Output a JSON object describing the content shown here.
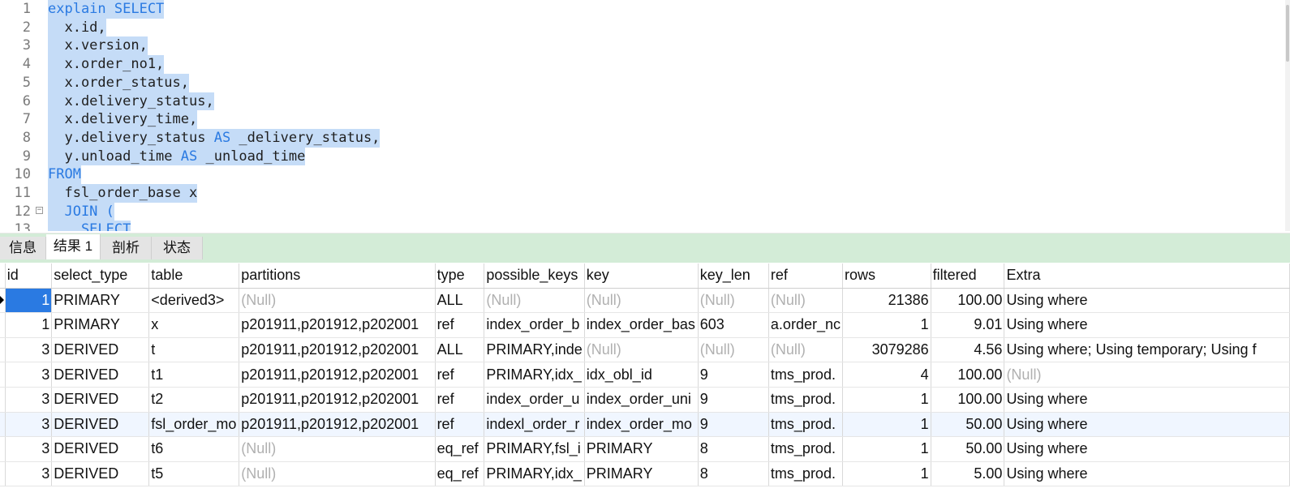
{
  "editor": {
    "lines": [
      {
        "num": "1",
        "parts": [
          {
            "t": "explain SELECT",
            "k": true
          }
        ]
      },
      {
        "num": "2",
        "parts": [
          {
            "t": "  x.id,",
            "k": false
          }
        ]
      },
      {
        "num": "3",
        "parts": [
          {
            "t": "  x.version,",
            "k": false
          }
        ]
      },
      {
        "num": "4",
        "parts": [
          {
            "t": "  x.order_no1,",
            "k": false
          }
        ]
      },
      {
        "num": "5",
        "parts": [
          {
            "t": "  x.order_status,",
            "k": false
          }
        ]
      },
      {
        "num": "6",
        "parts": [
          {
            "t": "  x.delivery_status,",
            "k": false
          }
        ]
      },
      {
        "num": "7",
        "parts": [
          {
            "t": "  x.delivery_time,",
            "k": false
          }
        ]
      },
      {
        "num": "8",
        "parts": [
          {
            "t": "  y.delivery_status ",
            "k": false
          },
          {
            "t": "AS",
            "k": true
          },
          {
            "t": " _delivery_status,",
            "k": false
          }
        ]
      },
      {
        "num": "9",
        "parts": [
          {
            "t": "  y.unload_time ",
            "k": false
          },
          {
            "t": "AS",
            "k": true
          },
          {
            "t": " _unload_time",
            "k": false
          }
        ]
      },
      {
        "num": "10",
        "parts": [
          {
            "t": "FROM",
            "k": true
          }
        ]
      },
      {
        "num": "11",
        "parts": [
          {
            "t": "  fsl_order_base x",
            "k": false
          }
        ]
      },
      {
        "num": "12",
        "parts": [
          {
            "t": "  JOIN (",
            "k": true
          }
        ],
        "fold": "⊟"
      },
      {
        "num": "13",
        "parts": [
          {
            "t": "    SELECT",
            "k": true
          }
        ]
      }
    ]
  },
  "tabs": [
    {
      "label": "信息",
      "active": false
    },
    {
      "label": "结果 1",
      "active": true
    },
    {
      "label": "剖析",
      "active": false
    },
    {
      "label": "状态",
      "active": false
    }
  ],
  "grid": {
    "columns": [
      "id",
      "select_type",
      "table",
      "partitions",
      "type",
      "possible_keys",
      "key",
      "key_len",
      "ref",
      "rows",
      "filtered",
      "Extra"
    ],
    "rows": [
      [
        "1",
        "PRIMARY",
        "<derived3>",
        "(Null)",
        "ALL",
        "(Null)",
        "(Null)",
        "(Null)",
        "(Null)",
        "21386",
        "100.00",
        "Using where"
      ],
      [
        "1",
        "PRIMARY",
        "x",
        "p201911,p201912,p202001",
        "ref",
        "index_order_b",
        "index_order_bas",
        "603",
        "a.order_nc",
        "1",
        "9.01",
        "Using where"
      ],
      [
        "3",
        "DERIVED",
        "t",
        "p201911,p201912,p202001",
        "ALL",
        "PRIMARY,inde",
        "(Null)",
        "(Null)",
        "(Null)",
        "3079286",
        "4.56",
        "Using where; Using temporary; Using f"
      ],
      [
        "3",
        "DERIVED",
        "t1",
        "p201911,p201912,p202001",
        "ref",
        "PRIMARY,idx_",
        "idx_obl_id",
        "9",
        "tms_prod.",
        "4",
        "100.00",
        "(Null)"
      ],
      [
        "3",
        "DERIVED",
        "t2",
        "p201911,p201912,p202001",
        "ref",
        "index_order_u",
        "index_order_uni",
        "9",
        "tms_prod.",
        "1",
        "100.00",
        "Using where"
      ],
      [
        "3",
        "DERIVED",
        "fsl_order_mo",
        "p201911,p201912,p202001",
        "ref",
        "indexl_order_r",
        "index_order_mo",
        "9",
        "tms_prod.",
        "1",
        "50.00",
        "Using where"
      ],
      [
        "3",
        "DERIVED",
        "t6",
        "(Null)",
        "eq_ref",
        "PRIMARY,fsl_i",
        "PRIMARY",
        "8",
        "tms_prod.",
        "1",
        "50.00",
        "Using where"
      ],
      [
        "3",
        "DERIVED",
        "t5",
        "(Null)",
        "eq_ref",
        "PRIMARY,idx_",
        "PRIMARY",
        "8",
        "tms_prod.",
        "1",
        "5.00",
        "Using where"
      ]
    ],
    "selected_row": 0,
    "null_text": "(Null)"
  }
}
